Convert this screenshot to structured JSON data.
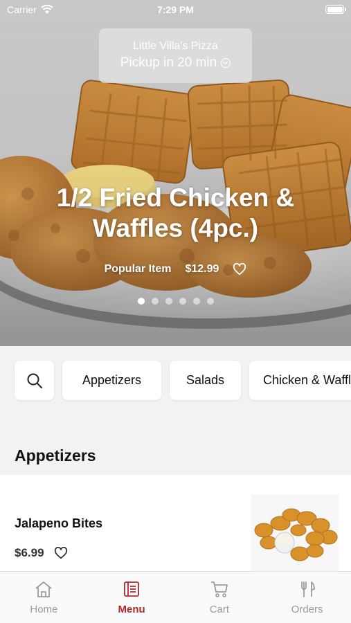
{
  "status_bar": {
    "carrier": "Carrier",
    "time": "7:29 PM"
  },
  "store": {
    "name": "Little Villa's Pizza",
    "pickup": "Pickup in 20 min"
  },
  "featured": {
    "title_line1": "1/2 Fried Chicken &",
    "title_line2": "Waffles (4pc.)",
    "tag": "Popular Item",
    "price": "$12.99",
    "slides": 6,
    "active_slide": 1
  },
  "categories": [
    {
      "label": "Appetizers"
    },
    {
      "label": "Salads"
    },
    {
      "label": "Chicken & Waffles"
    }
  ],
  "section": {
    "title": "Appetizers"
  },
  "items": [
    {
      "name": "Jalapeno Bites",
      "price": "$6.99",
      "favorited": false
    }
  ],
  "tabs": [
    {
      "label": "Home",
      "icon": "home-icon",
      "active": false
    },
    {
      "label": "Menu",
      "icon": "menu-icon",
      "active": true
    },
    {
      "label": "Cart",
      "icon": "cart-icon",
      "active": false
    },
    {
      "label": "Orders",
      "icon": "fork-knife-icon",
      "active": false
    }
  ],
  "colors": {
    "accent": "#b3262a",
    "inactive_tab": "#9b9b9b",
    "background": "#f2f2f4"
  }
}
